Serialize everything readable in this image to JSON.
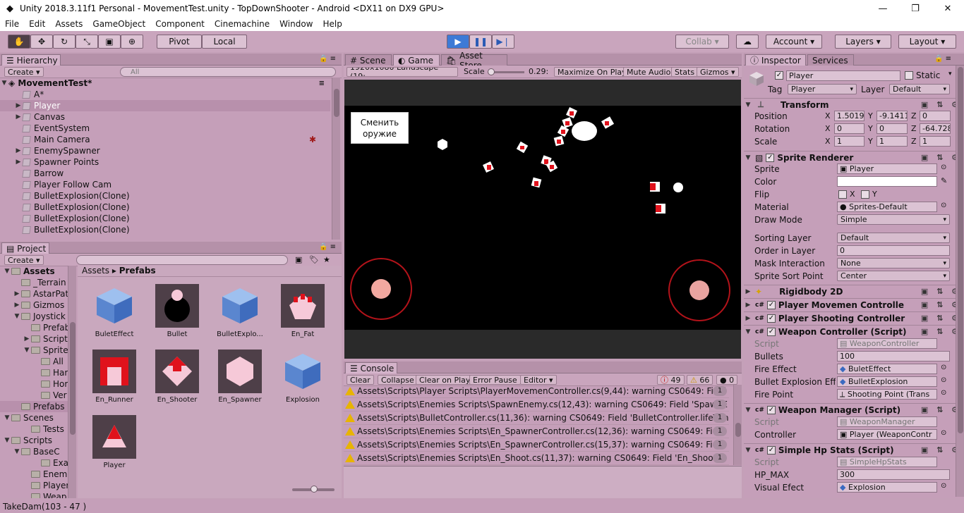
{
  "title_bar": {
    "title": "Unity 2018.3.11f1 Personal - MovementTest.unity - TopDownShooter - Android <DX11 on DX9 GPU>"
  },
  "menu": [
    "File",
    "Edit",
    "Assets",
    "GameObject",
    "Component",
    "Cinemachine",
    "Window",
    "Help"
  ],
  "toolbar": {
    "pivot": "Pivot",
    "local": "Local",
    "collab": "Collab ▾",
    "account": "Account",
    "layers": "Layers",
    "layout": "Layout"
  },
  "hierarchy": {
    "tab": "Hierarchy",
    "create": "Create",
    "search_placeholder": "All",
    "scene": "MovementTest*",
    "items": [
      "A*",
      "Player",
      "Canvas",
      "EventSystem",
      "Main Camera",
      "EnemySpawner",
      "Spawner Points",
      "Barrow",
      "Player Follow Cam",
      "BulletExplosion(Clone)",
      "BulletExplosion(Clone)",
      "BulletExplosion(Clone)",
      "BulletExplosion(Clone)"
    ]
  },
  "project": {
    "tab": "Project",
    "create": "Create",
    "tree": [
      "Assets",
      "_Terrain",
      "AstarPat",
      "Gizmos",
      "Joystick",
      "Prefab",
      "Script",
      "Sprite",
      "All",
      "Har",
      "Hor",
      "Ver",
      "Prefabs",
      "Scenes",
      "Tests",
      "Scripts",
      "BaseC",
      "Exa",
      "Enem",
      "Player",
      "Weap"
    ],
    "breadcrumb_root": "Assets",
    "breadcrumb_leaf": "Prefabs",
    "assets": [
      "BuletEffect",
      "Bullet",
      "BulletExplo...",
      "En_Fat",
      "En_Runner",
      "En_Shooter",
      "En_Spawner",
      "Explosion",
      "Player"
    ]
  },
  "scene_tabs": {
    "scene": "Scene",
    "game": "Game",
    "store": "Asset Store"
  },
  "game_bar": {
    "resolution": "1920x1080 Landscape (19:",
    "scale_label": "Scale",
    "scale_value": "0.29:",
    "maximize": "Maximize On Play",
    "mute": "Mute Audio",
    "stats": "Stats",
    "gizmos": "Gizmos"
  },
  "game_view": {
    "button_text": "Сменить оружие"
  },
  "console": {
    "tab": "Console",
    "clear": "Clear",
    "collapse": "Collapse",
    "clear_on_play": "Clear on Play",
    "error_pause": "Error Pause",
    "editor": "Editor",
    "counts": {
      "errors": "49",
      "warnings": "66",
      "messages": "0"
    },
    "lines": [
      {
        "text": "Assets\\Scripts\\Player Scripts\\PlayerMovemenController.cs(9,44): warning CS0649: Field",
        "count": "1"
      },
      {
        "text": "Assets\\Scripts\\Enemies Scripts\\SpawnEnemy.cs(12,43): warning CS0649: Field 'SpawnE",
        "count": "1"
      },
      {
        "text": "Assets\\Scripts\\BulletController.cs(11,36): warning CS0649: Field 'BulletController.lifeTim",
        "count": "1"
      },
      {
        "text": "Assets\\Scripts\\Enemies Scripts\\En_SpawnerController.cs(12,36): warning CS0649: Field",
        "count": "1"
      },
      {
        "text": "Assets\\Scripts\\Enemies Scripts\\En_SpawnerController.cs(15,37): warning CS0649: Field",
        "count": "1"
      },
      {
        "text": "Assets\\Scripts\\Enemies Scripts\\En_Shoot.cs(11,37): warning CS0649: Field 'En_Shoot.p",
        "count": "1"
      }
    ]
  },
  "inspector": {
    "tab": "Inspector",
    "services": "Services",
    "object_name": "Player",
    "static": "Static",
    "tag_label": "Tag",
    "tag": "Player",
    "layer_label": "Layer",
    "layer": "Default",
    "transform": {
      "title": "Transform",
      "position": "Position",
      "rotation": "Rotation",
      "scale": "Scale",
      "pos": [
        "1.5019",
        "-9.1411",
        "0"
      ],
      "rot": [
        "0",
        "0",
        "-64.728"
      ],
      "scl": [
        "1",
        "1",
        "1"
      ]
    },
    "sprite_renderer": {
      "title": "Sprite Renderer",
      "sprite_label": "Sprite",
      "sprite": "Player",
      "color_label": "Color",
      "flip_label": "Flip",
      "x": "X",
      "y": "Y",
      "material_label": "Material",
      "material": "Sprites-Default",
      "draw_mode_label": "Draw Mode",
      "draw_mode": "Simple",
      "sorting_layer_label": "Sorting Layer",
      "sorting_layer": "Default",
      "order_label": "Order in Layer",
      "order": "0",
      "mask_label": "Mask Interaction",
      "mask": "None",
      "sort_point_label": "Sprite Sort Point",
      "sort_point": "Center"
    },
    "rigidbody": "Rigidbody 2D",
    "movement": "Player Movemen Controlle",
    "shooting": "Player Shooting Controller",
    "weapon_controller": {
      "title": "Weapon Controller (Script)",
      "script_label": "Script",
      "script": "WeaponController",
      "bullets_label": "Bullets",
      "bullets": "100",
      "fire_effect_label": "Fire Effect",
      "fire_effect": "BuletEffect",
      "bullet_expl_label": "Bullet Explosion Effe",
      "bullet_expl": "BulletExplosion",
      "fire_point_label": "Fire Point",
      "fire_point": "Shooting Point (Trans"
    },
    "weapon_manager": {
      "title": "Weapon Manager (Script)",
      "script_label": "Script",
      "script": "WeaponManager",
      "controller_label": "Controller",
      "controller": "Player (WeaponContr"
    },
    "hp_stats": {
      "title": "Simple Hp Stats (Script)",
      "script_label": "Script",
      "script": "SimpleHpStats",
      "hp_label": "HP_MAX",
      "hp": "300",
      "visual_label": "Visual Efect",
      "visual": "Explosion"
    }
  },
  "status_bar": {
    "text": "TakeDam(103 - 47 )"
  }
}
